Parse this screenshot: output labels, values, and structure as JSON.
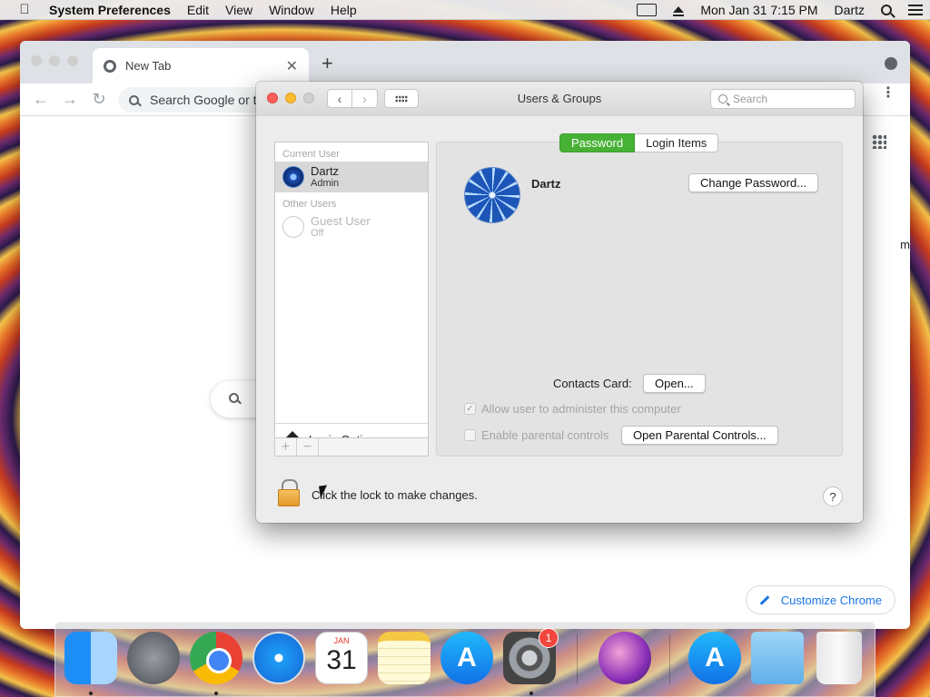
{
  "menubar": {
    "app_name": "System Preferences",
    "menus": [
      "Edit",
      "View",
      "Window",
      "Help"
    ],
    "clock": "Mon Jan 31  7:15 PM",
    "user": "Dartz"
  },
  "chrome": {
    "tab_title": "New Tab",
    "omnibox_placeholder": "Search Google or t",
    "customize_label": "Customize Chrome",
    "side_letter": "m"
  },
  "prefs": {
    "title": "Users & Groups",
    "search_placeholder": "Search",
    "sections": {
      "current": "Current User",
      "other": "Other Users"
    },
    "users": [
      {
        "name": "Dartz",
        "role": "Admin"
      },
      {
        "name": "Guest User",
        "role": "Off"
      }
    ],
    "login_options": "Login Options",
    "tabs": {
      "password": "Password",
      "login_items": "Login Items"
    },
    "selected_user": "Dartz",
    "change_password": "Change Password...",
    "contacts_card_label": "Contacts Card:",
    "open_button": "Open...",
    "allow_admin": "Allow user to administer this computer",
    "parental_controls": "Enable parental controls",
    "open_parental": "Open Parental Controls...",
    "lock_text": "Click the lock to make changes.",
    "help": "?"
  },
  "dock": {
    "calendar_month": "JAN",
    "calendar_day": "31",
    "sysprefs_badge": "1"
  }
}
